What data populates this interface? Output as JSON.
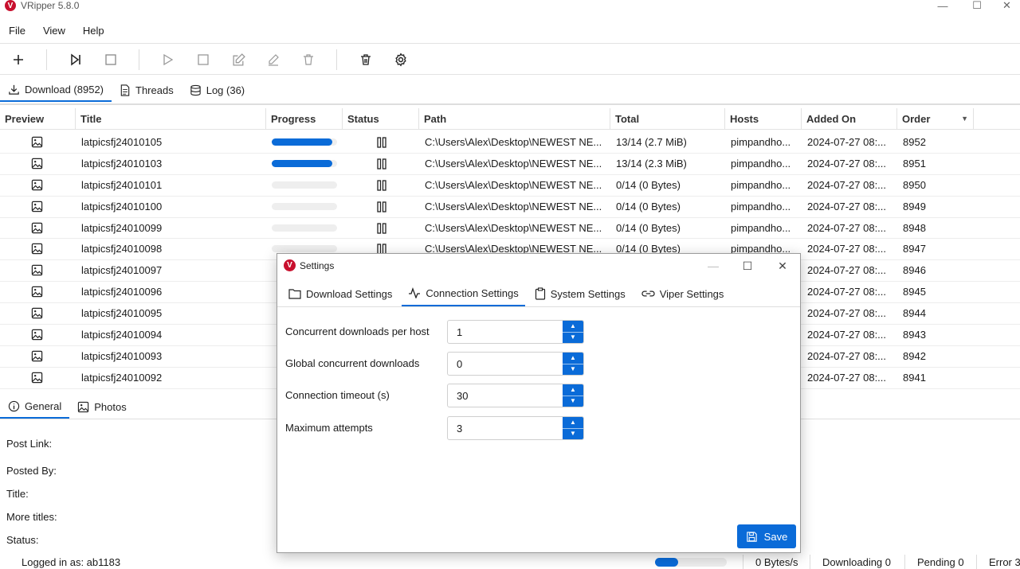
{
  "app": {
    "title": "VRipper 5.8.0",
    "logo_letter": "V"
  },
  "window_controls": {
    "minimize": "—",
    "maximize": "☐",
    "close": "✕"
  },
  "menu": {
    "items": [
      "File",
      "View",
      "Help"
    ]
  },
  "toolbar": {
    "buttons": [
      "add-icon",
      "skip-forward-icon",
      "stop-square-icon",
      "play-icon",
      "stop-square-icon",
      "edit-icon",
      "pencil-icon",
      "delete-icon",
      "trash-icon",
      "settings-icon"
    ]
  },
  "main_tabs": [
    {
      "label": "Download (8952)",
      "icon": "download-icon",
      "active": true
    },
    {
      "label": "Threads",
      "icon": "document-icon",
      "active": false
    },
    {
      "label": "Log (36)",
      "icon": "database-icon",
      "active": false
    }
  ],
  "table": {
    "columns": [
      "Preview",
      "Title",
      "Progress",
      "Status",
      "Path",
      "Total",
      "Hosts",
      "Added On",
      "Order"
    ],
    "rows": [
      {
        "title": "latpicsfj24010105",
        "progress": 1.0,
        "path": "C:\\Users\\Alex\\Desktop\\NEWEST NE...",
        "total": "13/14 (2.7 MiB)",
        "hosts": "pimpandho...",
        "added": "2024-07-27 08:...",
        "order": "8952"
      },
      {
        "title": "latpicsfj24010103",
        "progress": 1.0,
        "path": "C:\\Users\\Alex\\Desktop\\NEWEST NE...",
        "total": "13/14 (2.3 MiB)",
        "hosts": "pimpandho...",
        "added": "2024-07-27 08:...",
        "order": "8951"
      },
      {
        "title": "latpicsfj24010101",
        "progress": 0,
        "path": "C:\\Users\\Alex\\Desktop\\NEWEST NE...",
        "total": "0/14 (0 Bytes)",
        "hosts": "pimpandho...",
        "added": "2024-07-27 08:...",
        "order": "8950"
      },
      {
        "title": "latpicsfj24010100",
        "progress": 0,
        "path": "C:\\Users\\Alex\\Desktop\\NEWEST NE...",
        "total": "0/14 (0 Bytes)",
        "hosts": "pimpandho...",
        "added": "2024-07-27 08:...",
        "order": "8949"
      },
      {
        "title": "latpicsfj24010099",
        "progress": 0,
        "path": "C:\\Users\\Alex\\Desktop\\NEWEST NE...",
        "total": "0/14 (0 Bytes)",
        "hosts": "pimpandho...",
        "added": "2024-07-27 08:...",
        "order": "8948"
      },
      {
        "title": "latpicsfj24010098",
        "progress": 0,
        "path": "C:\\Users\\Alex\\Desktop\\NEWEST NE...",
        "total": "0/14 (0 Bytes)",
        "hosts": "pimpandho...",
        "added": "2024-07-27 08:...",
        "order": "8947"
      },
      {
        "title": "latpicsfj24010097",
        "progress": 0,
        "path": "",
        "total": "",
        "hosts": "",
        "added": "2024-07-27 08:...",
        "order": "8946"
      },
      {
        "title": "latpicsfj24010096",
        "progress": 0,
        "path": "",
        "total": "",
        "hosts": "",
        "added": "2024-07-27 08:...",
        "order": "8945"
      },
      {
        "title": "latpicsfj24010095",
        "progress": 0,
        "path": "",
        "total": "",
        "hosts": "",
        "added": "2024-07-27 08:...",
        "order": "8944"
      },
      {
        "title": "latpicsfj24010094",
        "progress": 0,
        "path": "",
        "total": "",
        "hosts": "",
        "added": "2024-07-27 08:...",
        "order": "8943"
      },
      {
        "title": "latpicsfj24010093",
        "progress": 0,
        "path": "",
        "total": "",
        "hosts": "",
        "added": "2024-07-27 08:...",
        "order": "8942"
      },
      {
        "title": "latpicsfj24010092",
        "progress": 0,
        "path": "",
        "total": "",
        "hosts": "",
        "added": "2024-07-27 08:...",
        "order": "8941"
      }
    ]
  },
  "detail_tabs": [
    {
      "label": "General",
      "icon": "info-icon",
      "active": true
    },
    {
      "label": "Photos",
      "icon": "image-icon",
      "active": false
    }
  ],
  "detail_labels": [
    "Post Link:",
    "Posted By:",
    "Title:",
    "More titles:",
    "Status:"
  ],
  "statusbar": {
    "logged_in": "Logged in as: ab1183",
    "speed_progress": 0.32,
    "speed": "0 Bytes/s",
    "downloading": "Downloading 0",
    "pending": "Pending 0",
    "error": "Error 3"
  },
  "dialog": {
    "title": "Settings",
    "logo_letter": "V",
    "tabs": [
      {
        "label": "Download Settings",
        "icon": "folder-icon",
        "active": false
      },
      {
        "label": "Connection Settings",
        "icon": "activity-icon",
        "active": true
      },
      {
        "label": "System Settings",
        "icon": "clipboard-icon",
        "active": false
      },
      {
        "label": "Viper Settings",
        "icon": "link-icon",
        "active": false
      }
    ],
    "fields": [
      {
        "label": "Concurrent downloads per host",
        "value": "1"
      },
      {
        "label": "Global concurrent downloads",
        "value": "0"
      },
      {
        "label": "Connection timeout (s)",
        "value": "30"
      },
      {
        "label": "Maximum attempts",
        "value": "3"
      }
    ],
    "save_label": "Save"
  },
  "colors": {
    "accent": "#0a6bd8",
    "brand": "#c8102e"
  }
}
